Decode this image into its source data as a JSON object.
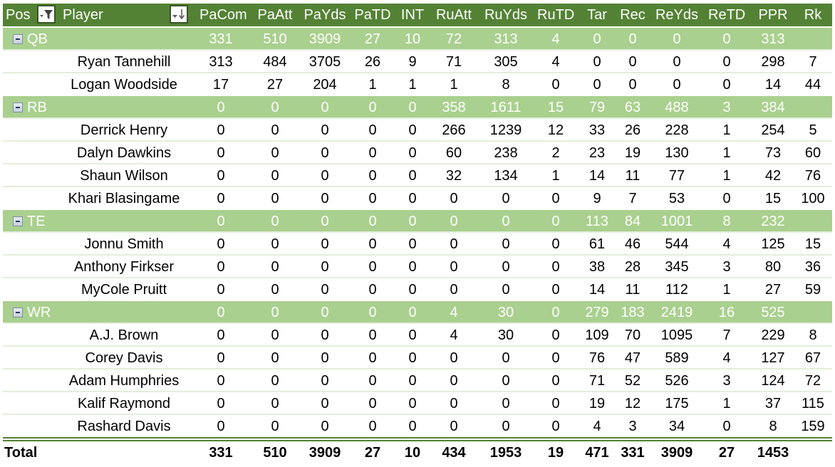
{
  "header": {
    "pos_label": "Pos",
    "player_label": "Player",
    "filter_button_icon": "filter-dropdown-icon",
    "sort_button_icon": "sort-descending-icon",
    "columns": [
      "PaCom",
      "PaAtt",
      "PaYds",
      "PaTD",
      "INT",
      "RuAtt",
      "RuYds",
      "RuTD",
      "Tar",
      "Rec",
      "ReYds",
      "ReTD",
      "PPR",
      "Rk"
    ]
  },
  "groups": [
    {
      "label": "QB",
      "icon": "collapse-minus-icon",
      "values": [
        "331",
        "510",
        "3909",
        "27",
        "10",
        "72",
        "313",
        "4",
        "0",
        "0",
        "0",
        "0",
        "313",
        ""
      ],
      "players": [
        {
          "name": "Ryan Tannehill",
          "values": [
            "313",
            "484",
            "3705",
            "26",
            "9",
            "71",
            "305",
            "4",
            "0",
            "0",
            "0",
            "0",
            "298",
            "7"
          ]
        },
        {
          "name": "Logan Woodside",
          "values": [
            "17",
            "27",
            "204",
            "1",
            "1",
            "1",
            "8",
            "0",
            "0",
            "0",
            "0",
            "0",
            "14",
            "44"
          ]
        }
      ]
    },
    {
      "label": "RB",
      "icon": "collapse-minus-icon",
      "values": [
        "0",
        "0",
        "0",
        "0",
        "0",
        "358",
        "1611",
        "15",
        "79",
        "63",
        "488",
        "3",
        "384",
        ""
      ],
      "players": [
        {
          "name": "Derrick Henry",
          "values": [
            "0",
            "0",
            "0",
            "0",
            "0",
            "266",
            "1239",
            "12",
            "33",
            "26",
            "228",
            "1",
            "254",
            "5"
          ]
        },
        {
          "name": "Dalyn Dawkins",
          "values": [
            "0",
            "0",
            "0",
            "0",
            "0",
            "60",
            "238",
            "2",
            "23",
            "19",
            "130",
            "1",
            "73",
            "60"
          ]
        },
        {
          "name": "Shaun Wilson",
          "values": [
            "0",
            "0",
            "0",
            "0",
            "0",
            "32",
            "134",
            "1",
            "14",
            "11",
            "77",
            "1",
            "42",
            "76"
          ]
        },
        {
          "name": "Khari Blasingame",
          "values": [
            "0",
            "0",
            "0",
            "0",
            "0",
            "0",
            "0",
            "0",
            "9",
            "7",
            "53",
            "0",
            "15",
            "100"
          ]
        }
      ]
    },
    {
      "label": "TE",
      "icon": "collapse-minus-icon",
      "values": [
        "0",
        "0",
        "0",
        "0",
        "0",
        "0",
        "0",
        "0",
        "113",
        "84",
        "1001",
        "8",
        "232",
        ""
      ],
      "players": [
        {
          "name": "Jonnu Smith",
          "values": [
            "0",
            "0",
            "0",
            "0",
            "0",
            "0",
            "0",
            "0",
            "61",
            "46",
            "544",
            "4",
            "125",
            "15"
          ]
        },
        {
          "name": "Anthony Firkser",
          "values": [
            "0",
            "0",
            "0",
            "0",
            "0",
            "0",
            "0",
            "0",
            "38",
            "28",
            "345",
            "3",
            "80",
            "36"
          ]
        },
        {
          "name": "MyCole Pruitt",
          "values": [
            "0",
            "0",
            "0",
            "0",
            "0",
            "0",
            "0",
            "0",
            "14",
            "11",
            "112",
            "1",
            "27",
            "59"
          ]
        }
      ]
    },
    {
      "label": "WR",
      "icon": "collapse-minus-icon",
      "values": [
        "0",
        "0",
        "0",
        "0",
        "0",
        "4",
        "30",
        "0",
        "279",
        "183",
        "2419",
        "16",
        "525",
        ""
      ],
      "players": [
        {
          "name": "A.J. Brown",
          "values": [
            "0",
            "0",
            "0",
            "0",
            "0",
            "4",
            "30",
            "0",
            "109",
            "70",
            "1095",
            "7",
            "229",
            "8"
          ]
        },
        {
          "name": "Corey Davis",
          "values": [
            "0",
            "0",
            "0",
            "0",
            "0",
            "0",
            "0",
            "0",
            "76",
            "47",
            "589",
            "4",
            "127",
            "67"
          ]
        },
        {
          "name": "Adam Humphries",
          "values": [
            "0",
            "0",
            "0",
            "0",
            "0",
            "0",
            "0",
            "0",
            "71",
            "52",
            "526",
            "3",
            "124",
            "72"
          ]
        },
        {
          "name": "Kalif Raymond",
          "values": [
            "0",
            "0",
            "0",
            "0",
            "0",
            "0",
            "0",
            "0",
            "19",
            "12",
            "175",
            "1",
            "37",
            "115"
          ]
        },
        {
          "name": "Rashard Davis",
          "values": [
            "0",
            "0",
            "0",
            "0",
            "0",
            "0",
            "0",
            "0",
            "4",
            "3",
            "34",
            "0",
            "8",
            "159"
          ]
        }
      ]
    }
  ],
  "total": {
    "label": "Total",
    "values": [
      "331",
      "510",
      "3909",
      "27",
      "10",
      "434",
      "1953",
      "19",
      "471",
      "331",
      "3909",
      "27",
      "1453",
      ""
    ]
  },
  "colors": {
    "header_bg": "#548235",
    "group_bg": "#a9d08e",
    "row_divider": "#e2efda"
  }
}
